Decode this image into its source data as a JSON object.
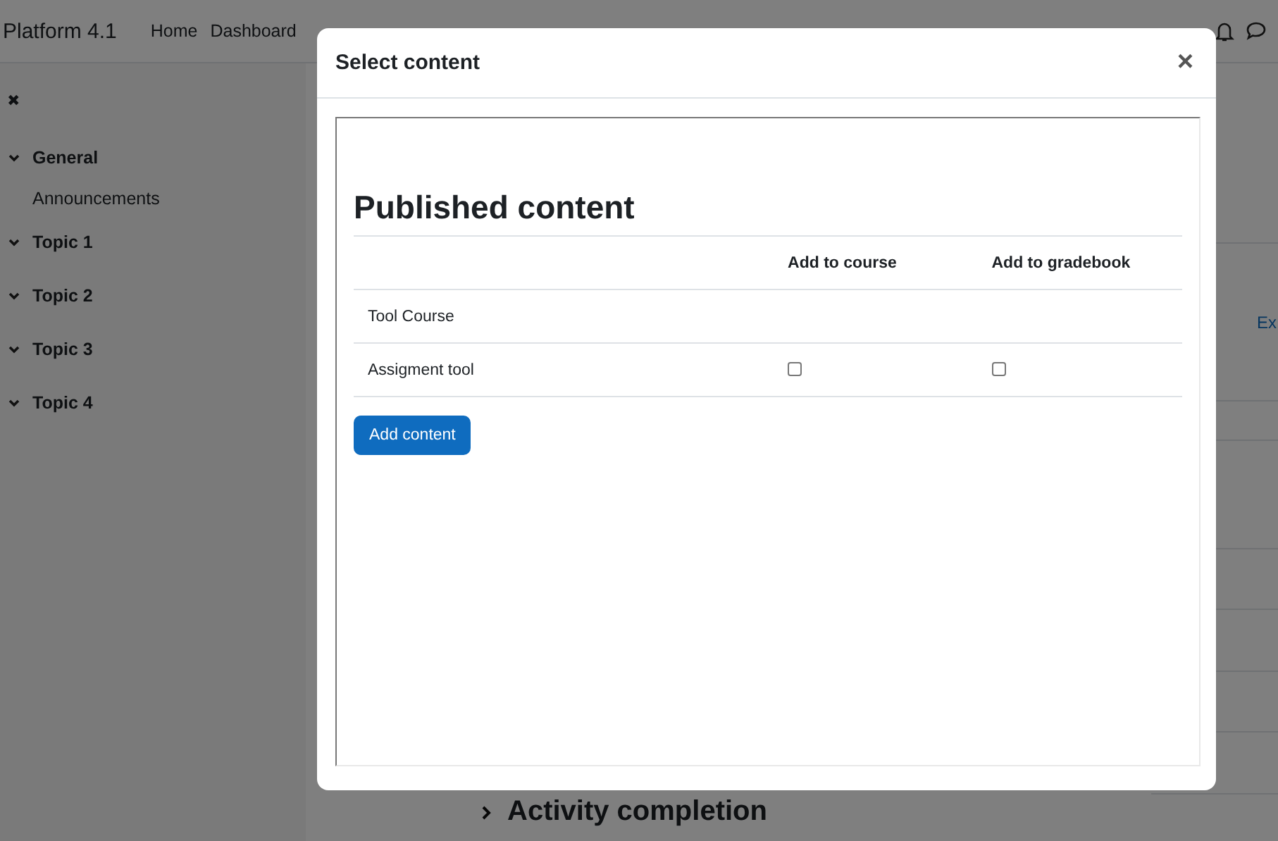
{
  "navbar": {
    "brand": "Platform 4.1",
    "links": [
      "Home",
      "Dashboard"
    ]
  },
  "sidebar": {
    "close_icon": "✖",
    "sections": [
      {
        "title": "General",
        "expanded": true,
        "children": [
          {
            "title": "Announcements"
          }
        ]
      },
      {
        "title": "Topic 1",
        "expanded": true
      },
      {
        "title": "Topic 2",
        "expanded": true
      },
      {
        "title": "Topic 3",
        "expanded": true
      },
      {
        "title": "Topic 4",
        "expanded": true
      }
    ]
  },
  "page": {
    "link": "Ex",
    "section_heading": "Activity completion"
  },
  "modal": {
    "title": "Select content",
    "close": "×",
    "heading": "Published content",
    "columns": [
      "Add to course",
      "Add to gradebook"
    ],
    "rows": [
      {
        "name": "Tool Course"
      },
      {
        "name": "Assigment tool",
        "add_to_course": {
          "checked": false
        },
        "add_to_gradebook": {
          "checked": false
        }
      }
    ],
    "button": "Add content"
  }
}
